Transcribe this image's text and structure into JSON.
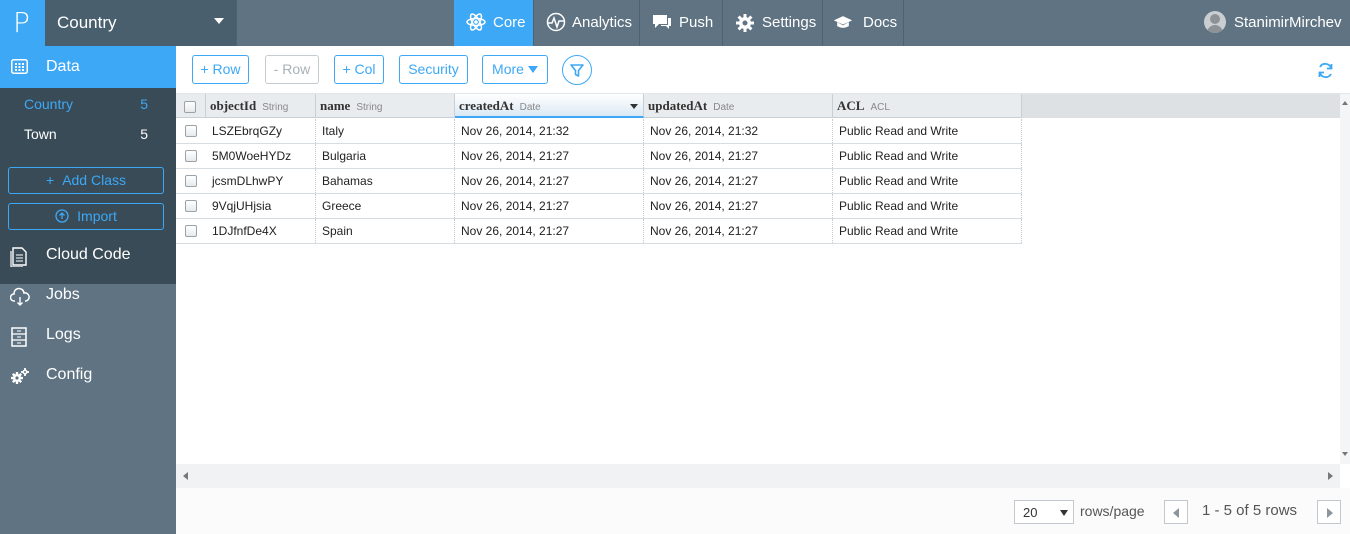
{
  "app": {
    "logo_letter": "P",
    "current_app": "Country"
  },
  "topnav": [
    {
      "label": "Core",
      "icon": "atom-icon",
      "active": true
    },
    {
      "label": "Analytics",
      "icon": "pulse-icon",
      "active": false
    },
    {
      "label": "Push",
      "icon": "chat-icon",
      "active": false
    },
    {
      "label": "Settings",
      "icon": "gear-icon",
      "active": false
    },
    {
      "label": "Docs",
      "icon": "graduation-cap-icon",
      "active": false
    }
  ],
  "user": {
    "name": "StanimirMirchev"
  },
  "sidebar": {
    "data_label": "Data",
    "classes": [
      {
        "name": "Country",
        "count": "5",
        "active": true
      },
      {
        "name": "Town",
        "count": "5",
        "active": false
      }
    ],
    "add_class_label": "Add Class",
    "import_label": "Import",
    "links": [
      {
        "label": "Cloud Code",
        "icon": "document-icon"
      },
      {
        "label": "Jobs",
        "icon": "cloud-icon"
      },
      {
        "label": "Logs",
        "icon": "cabinet-icon"
      },
      {
        "label": "Config",
        "icon": "gears-icon"
      }
    ]
  },
  "toolbar": {
    "add_row": "+ Row",
    "remove_row": "- Row",
    "add_col": "+ Col",
    "security": "Security",
    "more": "More"
  },
  "table": {
    "columns": [
      {
        "name": "objectId",
        "type": "String"
      },
      {
        "name": "name",
        "type": "String"
      },
      {
        "name": "createdAt",
        "type": "Date",
        "sorted": true
      },
      {
        "name": "updatedAt",
        "type": "Date"
      },
      {
        "name": "ACL",
        "type": "ACL"
      }
    ],
    "rows": [
      [
        "LSZEbrqGZy",
        "Italy",
        "Nov 26, 2014, 21:32",
        "Nov 26, 2014, 21:32",
        "Public Read and Write"
      ],
      [
        "5M0WoeHYDz",
        "Bulgaria",
        "Nov 26, 2014, 21:27",
        "Nov 26, 2014, 21:27",
        "Public Read and Write"
      ],
      [
        "jcsmDLhwPY",
        "Bahamas",
        "Nov 26, 2014, 21:27",
        "Nov 26, 2014, 21:27",
        "Public Read and Write"
      ],
      [
        "9VqjUHjsia",
        "Greece",
        "Nov 26, 2014, 21:27",
        "Nov 26, 2014, 21:27",
        "Public Read and Write"
      ],
      [
        "1DJfnfDe4X",
        "Spain",
        "Nov 26, 2014, 21:27",
        "Nov 26, 2014, 21:27",
        "Public Read and Write"
      ]
    ]
  },
  "footer": {
    "rows_per_page": "20",
    "rows_label": "rows/page",
    "range_text": "1 - 5 of 5 rows"
  },
  "colors": {
    "accent": "#3da8f5",
    "nav_bg": "#5f7382",
    "sidebar_dark": "#394b57"
  }
}
